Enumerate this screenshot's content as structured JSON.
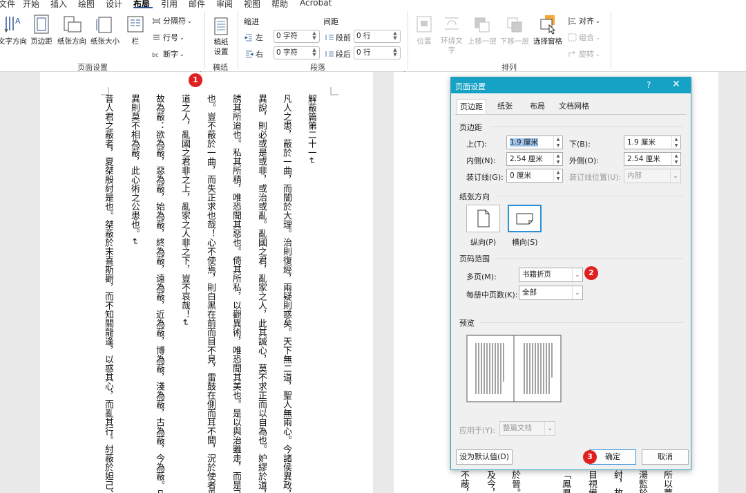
{
  "menubar": {
    "tabs": [
      "文件",
      "开始",
      "插入",
      "绘图",
      "设计",
      "布局",
      "引用",
      "邮件",
      "审阅",
      "视图",
      "帮助",
      "Acrobat"
    ],
    "active": "布局"
  },
  "ribbon": {
    "page_setup": {
      "group_label": "页面设置",
      "text_direction": "文字方向",
      "margins": "页边距",
      "orientation": "纸张方向",
      "size": "纸张大小",
      "columns": "栏",
      "breaks": "分隔符",
      "line_numbers": "行号",
      "hyphenation": "断字"
    },
    "manuscript": {
      "group_label": "稿纸",
      "button": "稿纸设置"
    },
    "paragraph": {
      "group_label": "段落",
      "indent": "缩进",
      "spacing": "间距",
      "left_label": "左",
      "left_value": "0 字符",
      "right_label": "右",
      "right_value": "0 字符",
      "before_label": "段前",
      "before_value": "0 行",
      "after_label": "段后",
      "after_value": "0 行"
    },
    "arrange": {
      "group_label": "排列",
      "position": "位置",
      "wrap_text": "环绕文字",
      "bring_forward": "上移一层",
      "send_backward": "下移一层",
      "selection_pane": "选择窗格",
      "align": "对齐",
      "group": "组合",
      "rotate": "旋转"
    }
  },
  "badges": {
    "b1": "1",
    "b2": "2",
    "b3": "3"
  },
  "document": {
    "columns": [
      "解蔽篇第二十一↵",
      "凡人之患，蔽於一曲，而闇於大理。治則復經，兩疑則惑矣。天下無二道，聖人無兩心。今諸侯異政，百家",
      "異說，則必或是或非，或治或亂。亂國之君，亂家之人，此其誠心，莫不求正而以自為也。妒繆於道，而人",
      "誘其所迨也。私其所積，唯恐聞其惡也。倚其所私，以觀異術，唯恐聞其美也。是以與治雖走，而是己不輟",
      "也。豈不蔽於一曲，而失正求也哉！心不使焉，則白黑在前而目不見，雷鼓在側而耳不聞，況於使者乎？德",
      "道之人，亂國之君非之上，亂家之人非之下，豈不哀哉！↵",
      "故為蔽：欲為蔽，惡為蔽，始為蔽，終為蔽，遠為蔽，近為蔽，博為蔽，淺為蔽，古為蔽，今為蔽。凡萬物",
      "異則莫不相為蔽，此心術之公患也。↵",
      "昔人君之蔽者，夏桀殷紂是也。桀蔽於末喜斯觀，而不知關龍逢，以惑其心，而亂其行。紂蔽於妲己、飛廉，"
    ],
    "page2_columns": [
      "所以蕈",
      "湯監於",
      "紂，故",
      "目視備",
      "「鳳凰",
      "於晉。",
      "及今，",
      "不蔽，"
    ]
  },
  "dialog": {
    "title": "页面设置",
    "help": "?",
    "close": "✕",
    "tabs": [
      "页边距",
      "纸张",
      "布局",
      "文档网格"
    ],
    "active_tab": "页边距",
    "margins_section": "页边距",
    "top_label": "上(T):",
    "top_value": "1.9 厘米",
    "bottom_label": "下(B):",
    "bottom_value": "1.9 厘米",
    "inside_label": "内侧(N):",
    "inside_value": "2.54 厘米",
    "outside_label": "外侧(O):",
    "outside_value": "2.54 厘米",
    "gutter_label": "装订线(G):",
    "gutter_value": "0 厘米",
    "gutter_pos_label": "装订线位置(U):",
    "gutter_pos_value": "内部",
    "orientation_section": "纸张方向",
    "portrait": "纵向(P)",
    "landscape": "横向(S)",
    "pages_section": "页码范围",
    "multiple_pages_label": "多页(M):",
    "multiple_pages_value": "书籍折页",
    "sheets_label": "每册中页数(K):",
    "sheets_value": "全部",
    "preview_section": "预览",
    "apply_label": "应用于(Y):",
    "apply_value": "整篇文档",
    "set_default": "设为默认值(D)",
    "ok": "确定",
    "cancel": "取消"
  }
}
